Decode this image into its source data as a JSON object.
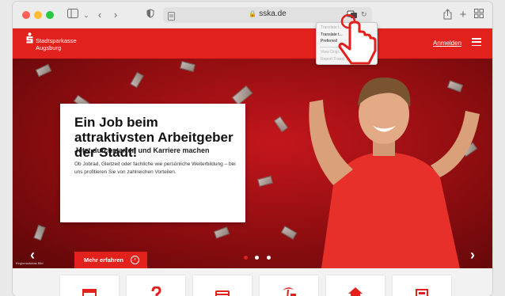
{
  "browser": {
    "url": "sska.de",
    "lock_icon": "lock-icon",
    "traffic_lights": [
      "#ff5f57",
      "#febc2e",
      "#28c840"
    ]
  },
  "translate_menu": {
    "items": [
      {
        "label": "Translate t...",
        "enabled": false
      },
      {
        "label": "Translate t...",
        "enabled": true
      },
      {
        "label": "Preferred",
        "enabled": true
      },
      {
        "label": "View Origi...",
        "enabled": false
      },
      {
        "label": "Report Transl...",
        "enabled": false
      }
    ]
  },
  "site": {
    "brand_line1": "Stadtsparkasse",
    "brand_line2": "Augsburg",
    "login": "Anmelden",
    "accent": "#e2211c"
  },
  "hero": {
    "headline": "Ein Job beim attraktivsten Arbeitgeber der Stadt!",
    "subline": "Jetzt durchstarten und Karriere machen",
    "body": "Ob Jobrad, Gleitzeit oder fachliche wie persönliche Weiterbildung – bei uns profitieren Sie von zahlreichen Vorteilen.",
    "button": "Mehr erfahren",
    "credit": "Kirgiomarketas Bild",
    "slide_count": 3,
    "active_slide": 1
  },
  "tiles": {
    "icons": [
      "calendar-icon",
      "question-icon",
      "card-icon",
      "palm-tree-icon",
      "house-icon",
      "calculator-icon"
    ]
  }
}
